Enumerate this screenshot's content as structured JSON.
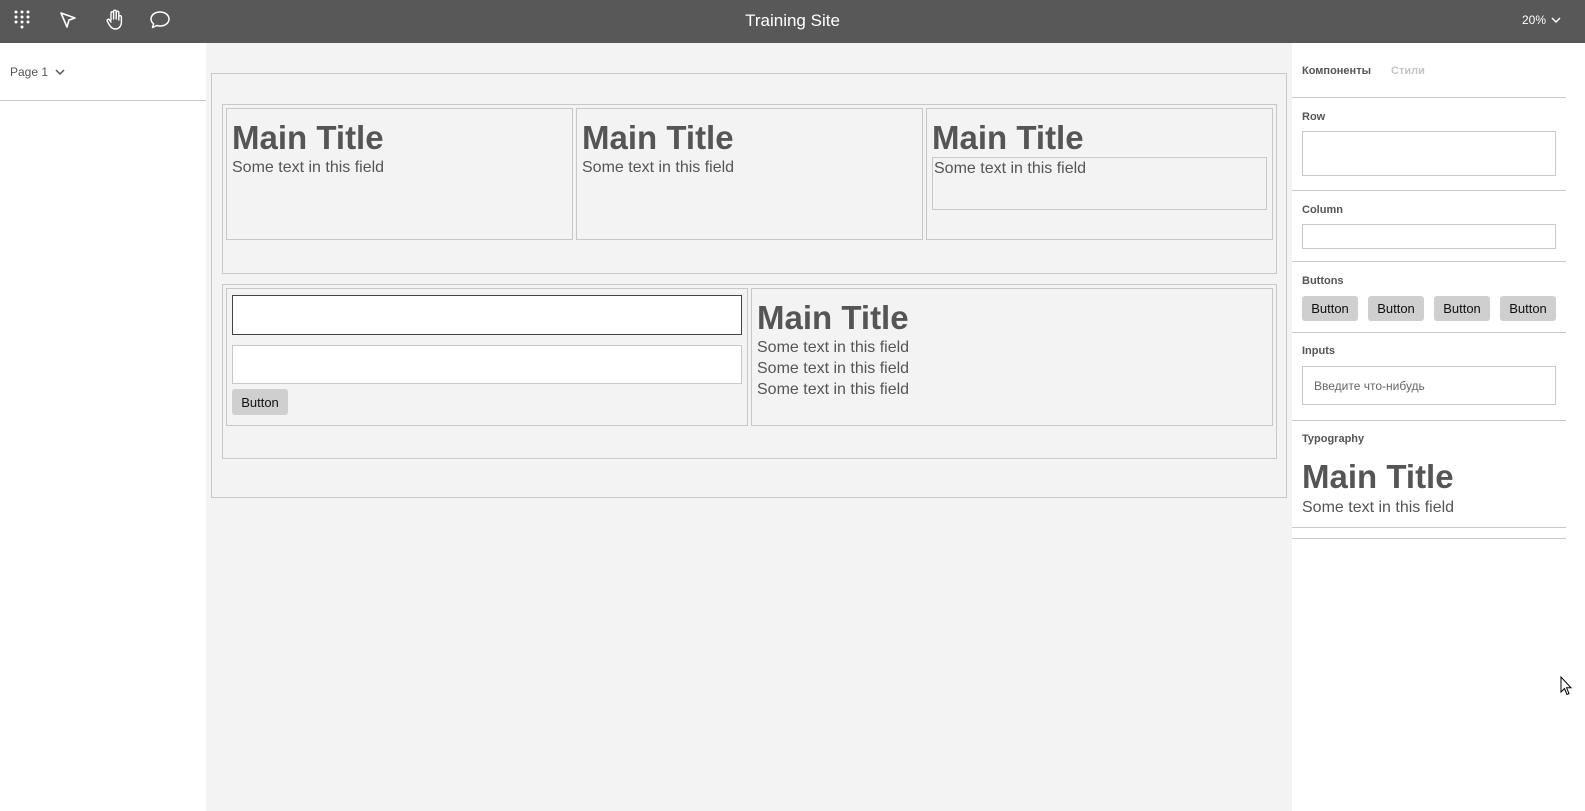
{
  "topbar": {
    "title": "Training Site",
    "zoom": "20%",
    "icons": [
      "apps-grid-icon",
      "pointer-arrow-icon",
      "hand-pan-icon",
      "comment-bubble-icon",
      "chevron-down-icon"
    ]
  },
  "left_panel": {
    "page_label": "Page 1"
  },
  "canvas": {
    "row1": [
      {
        "title": "Main Title",
        "text": "Some text in this field"
      },
      {
        "title": "Main Title",
        "text": "Some text in this field"
      },
      {
        "title": "Main Title",
        "text": "Some text in this field"
      }
    ],
    "row2": {
      "button_label": "Button",
      "title": "Main Title",
      "lines": [
        "Some text in this field",
        "Some text in this field",
        "Some text in this field"
      ]
    }
  },
  "right_panel": {
    "tabs": [
      "Компоненты",
      "Стили"
    ],
    "sections": {
      "row": "Row",
      "column": "Column",
      "buttons": "Buttons",
      "inputs": "Inputs",
      "typography": "Typography"
    },
    "buttons": [
      "Button",
      "Button",
      "Button",
      "Button"
    ],
    "input_placeholder": "Введите что-нибудь",
    "typography": {
      "title": "Main Title",
      "text": "Some text in this field"
    }
  },
  "colors": {
    "topbar": "#585858",
    "canvas": "#f3f3f3",
    "border": "#c8c8c8",
    "button": "#cfcfcf",
    "text": "#555555"
  }
}
